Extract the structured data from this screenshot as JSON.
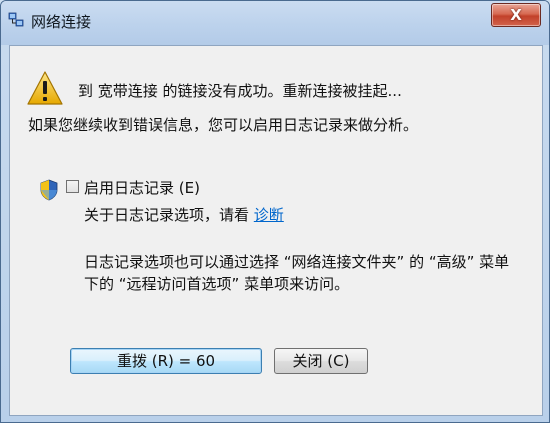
{
  "window": {
    "title": "网络连接",
    "close_glyph": "X"
  },
  "message": {
    "line1": "到 宽带连接 的链接没有成功。重新连接被挂起...",
    "line2": "如果您继续收到错误信息，您可以启用日志记录来做分析。"
  },
  "logging": {
    "checkbox_label": "启用日志记录 (E)",
    "checked": false,
    "diagnostics_prefix": "关于日志记录选项，请看 ",
    "diagnostics_link": "诊断"
  },
  "note": {
    "line1": "日志记录选项也可以通过选择 “网络连接文件夹” 的 “高级” 菜单",
    "line2": "下的 “远程访问首选项” 菜单项来访问。"
  },
  "buttons": {
    "redial_label": "重拨 (R) = 60",
    "close_label": "关闭 (C)"
  },
  "icons": {
    "title": "network-connection-icon",
    "warning": "warning-icon",
    "shield": "uac-shield-icon"
  },
  "colors": {
    "link": "#0066cc",
    "close_button": "#c2412a",
    "warning": "#f2c21a"
  }
}
